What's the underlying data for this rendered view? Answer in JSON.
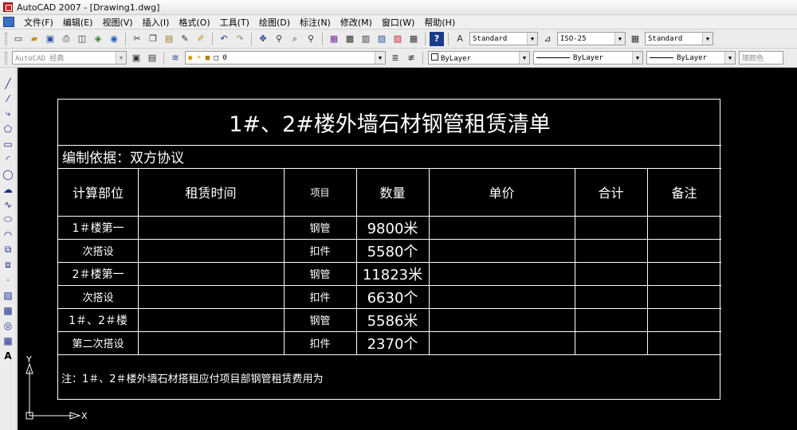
{
  "window": {
    "title": "AutoCAD 2007 - [Drawing1.dwg]"
  },
  "menu": [
    {
      "label": "文件(F)"
    },
    {
      "label": "编辑(E)"
    },
    {
      "label": "视图(V)"
    },
    {
      "label": "插入(I)"
    },
    {
      "label": "格式(O)"
    },
    {
      "label": "工具(T)"
    },
    {
      "label": "绘图(D)"
    },
    {
      "label": "标注(N)"
    },
    {
      "label": "修改(M)"
    },
    {
      "label": "窗口(W)"
    },
    {
      "label": "帮助(H)"
    }
  ],
  "toolbar1": {
    "text_style": "Standard",
    "dim_style": "ISO-25",
    "table_style": "Standard"
  },
  "toolbar2": {
    "workspace": "AutoCAD 经典",
    "layer": "0",
    "color": "ByLayer",
    "linetype": "ByLayer",
    "lineweight": "ByLayer",
    "plot_style": "随颜色"
  },
  "table": {
    "title": "1#、2#楼外墙石材钢管租赁清单",
    "basis": "编制依据：双方协议",
    "headers": [
      "计算部位",
      "租赁时间",
      "项目",
      "数量",
      "单价",
      "合计",
      "备注"
    ],
    "rows": [
      {
        "part": "1＃楼第一",
        "item": "钢管",
        "qty": "9800米"
      },
      {
        "part": "次搭设",
        "item": "扣件",
        "qty": "5580个"
      },
      {
        "part": "2＃楼第一",
        "item": "钢管",
        "qty": "11823米"
      },
      {
        "part": "次搭设",
        "item": "扣件",
        "qty": "6630个"
      },
      {
        "part": "1＃、2＃楼",
        "item": "钢管",
        "qty": "5586米"
      },
      {
        "part": "第二次搭设",
        "item": "扣件",
        "qty": "2370个"
      }
    ],
    "note": "注：1＃、2＃楼外墙石材搭租应付项目部钢管租赁费用为"
  },
  "ucs": {
    "y_label": "Y",
    "x_label": "X"
  }
}
